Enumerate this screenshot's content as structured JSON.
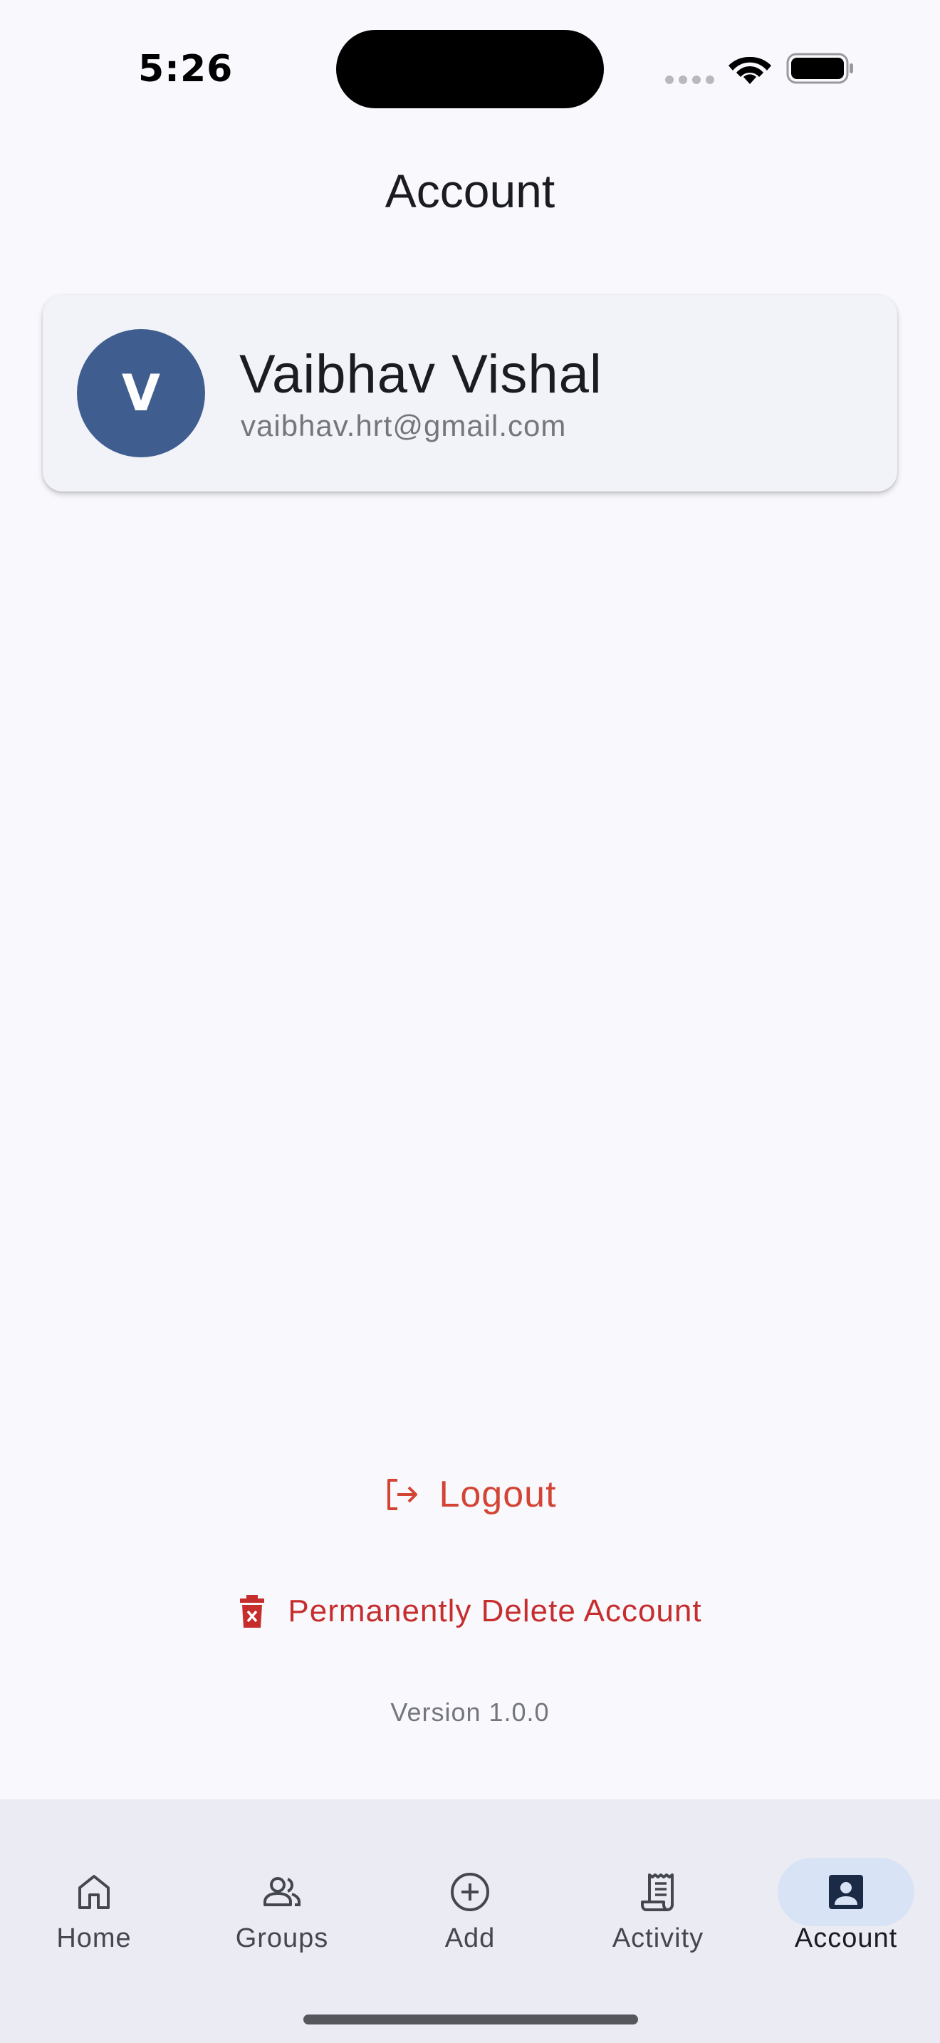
{
  "status_bar": {
    "time": "5:26"
  },
  "header": {
    "title": "Account"
  },
  "profile": {
    "initial": "V",
    "name": "Vaibhav Vishal",
    "email": "vaibhav.hrt@gmail.com",
    "avatar_color": "#3f5e8f"
  },
  "actions": {
    "logout_label": "Logout",
    "delete_label": "Permanently Delete Account",
    "danger_color": "#d44434"
  },
  "footer": {
    "version": "Version 1.0.0"
  },
  "bottom_nav": {
    "items": [
      {
        "label": "Home",
        "icon": "home-icon"
      },
      {
        "label": "Groups",
        "icon": "groups-icon"
      },
      {
        "label": "Add",
        "icon": "add-circle-icon"
      },
      {
        "label": "Activity",
        "icon": "receipt-icon"
      },
      {
        "label": "Account",
        "icon": "account-box-icon"
      }
    ],
    "active": "Account",
    "active_indicator_color": "#d9e3f6"
  }
}
